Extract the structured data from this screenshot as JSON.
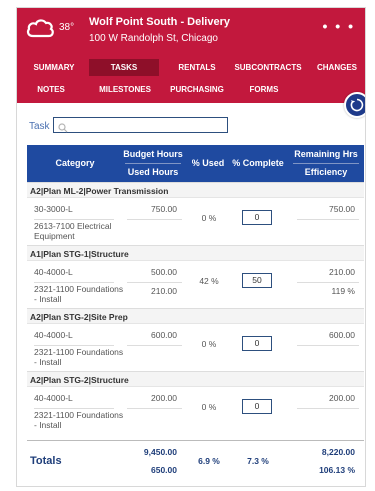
{
  "header": {
    "temperature": "38°",
    "job_title": "Wolf Point South - Delivery",
    "job_address": "100 W Randolph St, Chicago",
    "more_label": "• • •"
  },
  "nav": {
    "row1": [
      "SUMMARY",
      "TASKS",
      "RENTALS",
      "SUBCONTRACTS",
      "CHANGES"
    ],
    "row2": [
      "NOTES",
      "MILESTONES",
      "PURCHASING",
      "FORMS"
    ],
    "active": "TASKS"
  },
  "search": {
    "label": "Task",
    "value": "",
    "placeholder": ""
  },
  "table": {
    "headers": {
      "category": "Category",
      "budget_hours": "Budget Hours",
      "used_hours": "Used Hours",
      "pct_used": "% Used",
      "pct_complete": "% Complete",
      "remaining_hrs": "Remaining Hrs",
      "efficiency": "Efficiency"
    },
    "groups": [
      {
        "title": "A2|Plan ML-2|Power Transmission",
        "code": "30-3000-L",
        "cost_code": "2613-7100 Electrical Equipment",
        "budget": "750.00",
        "used": "",
        "pct_used": "0 %",
        "pct_complete": "0",
        "remaining": "750.00",
        "efficiency": ""
      },
      {
        "title": "A1|Plan STG-1|Structure",
        "code": "40-4000-L",
        "cost_code": "2321-1100 Foundations - Install",
        "budget": "500.00",
        "used": "210.00",
        "pct_used": "42 %",
        "pct_complete": "50",
        "remaining": "210.00",
        "efficiency": "119 %"
      },
      {
        "title": "A2|Plan STG-2|Site Prep",
        "code": "40-4000-L",
        "cost_code": "2321-1100 Foundations - Install",
        "budget": "600.00",
        "used": "",
        "pct_used": "0 %",
        "pct_complete": "0",
        "remaining": "600.00",
        "efficiency": ""
      },
      {
        "title": "A2|Plan STG-2|Structure",
        "code": "40-4000-L",
        "cost_code": "2321-1100 Foundations - Install",
        "budget": "200.00",
        "used": "",
        "pct_used": "0 %",
        "pct_complete": "0",
        "remaining": "200.00",
        "efficiency": ""
      }
    ]
  },
  "totals": {
    "label": "Totals",
    "budget": "9,450.00",
    "used": "650.00",
    "pct_used": "6.9 %",
    "pct_complete": "7.3 %",
    "remaining": "8,220.00",
    "efficiency": "106.13 %"
  },
  "colors": {
    "brand": "#c2183d",
    "brand_dark": "#8e0f29",
    "header_blue": "#1f4aa0",
    "accent_blue": "#1e3a8a"
  }
}
